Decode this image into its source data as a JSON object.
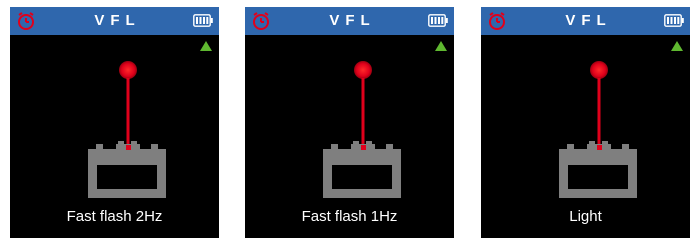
{
  "colors": {
    "topbar": "#2f67ad",
    "screen_bg": "#000000",
    "laser_red": "#e0001b",
    "device_gray": "#7f7f7f",
    "signal_green": "#5fb830"
  },
  "screens": [
    {
      "title": "VFL",
      "mode": "Fast flash 2Hz",
      "icons": [
        "timer-icon",
        "battery-icon",
        "signal-icon",
        "vfl-port-icon"
      ]
    },
    {
      "title": "VFL",
      "mode": "Fast flash 1Hz",
      "icons": [
        "timer-icon",
        "battery-icon",
        "signal-icon",
        "vfl-port-icon"
      ]
    },
    {
      "title": "VFL",
      "mode": "Light",
      "icons": [
        "timer-icon",
        "battery-icon",
        "signal-icon",
        "vfl-port-icon"
      ]
    }
  ]
}
